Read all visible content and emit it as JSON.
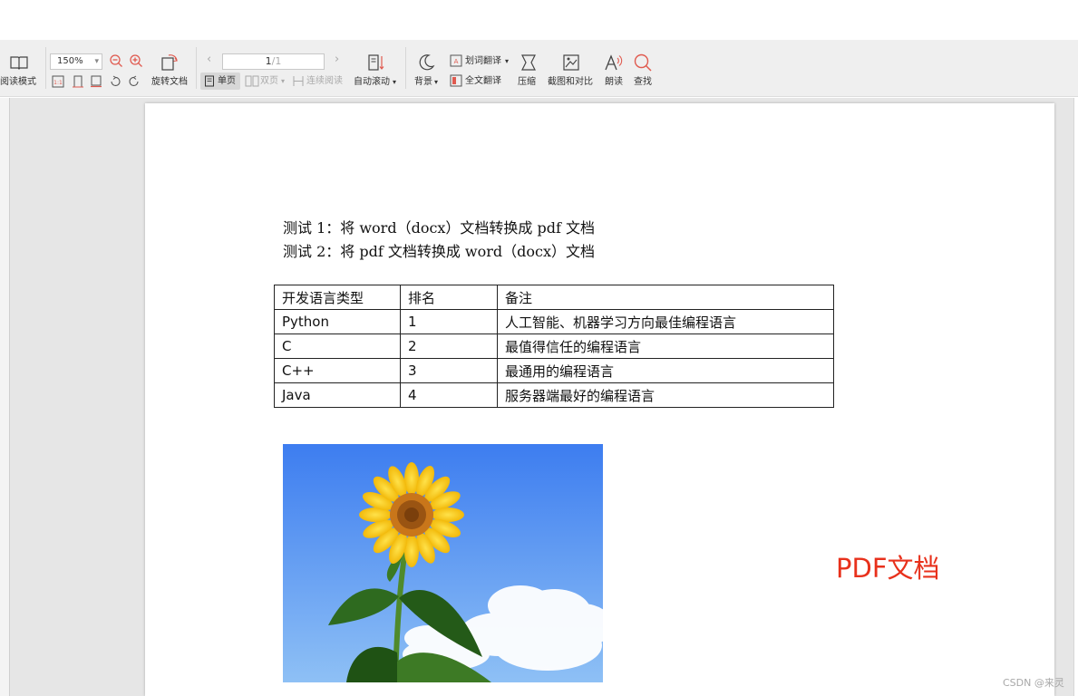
{
  "toolbar": {
    "reading_mode": "阅读模式",
    "zoom_value": "150%",
    "rotate_doc": "旋转文档",
    "page_current": "1",
    "page_total": "/1",
    "single_page": "单页",
    "double_page": "双页",
    "continuous_read": "连续阅读",
    "auto_scroll": "自动滚动",
    "background": "背景",
    "word_translate": "划词翻译",
    "full_translate": "全文翻译",
    "compress": "压缩",
    "screenshot_compare": "截图和对比",
    "read_aloud": "朗读",
    "find": "查找",
    "dropdown_glyph": "▾",
    "fit_label": "1:1",
    "accent_color": "#e05a4f"
  },
  "document": {
    "line1": "测试 1：将 word（docx）文档转换成 pdf 文档",
    "line2": "测试 2：将 pdf 文档转换成 word（docx）文档",
    "table": {
      "headers": [
        "开发语言类型",
        "排名",
        "备注"
      ],
      "rows": [
        [
          "Python",
          "1",
          "人工智能、机器学习方向最佳编程语言"
        ],
        [
          "C",
          "2",
          "最值得信任的编程语言"
        ],
        [
          "C++",
          "3",
          "最通用的编程语言"
        ],
        [
          "Java",
          "4",
          "服务器端最好的编程语言"
        ]
      ]
    }
  },
  "annotation": {
    "text": "PDF文档",
    "color": "#e8311c"
  },
  "watermark": "CSDN @来灵"
}
